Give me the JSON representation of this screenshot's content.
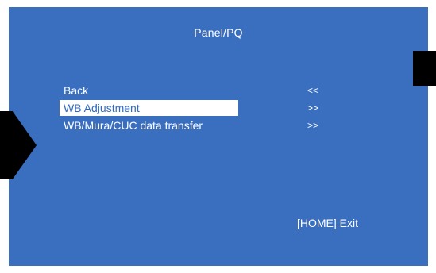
{
  "panel": {
    "title": "Panel/PQ"
  },
  "menu": {
    "items": [
      {
        "label": "Back",
        "arrow": "<<",
        "selected": false
      },
      {
        "label": "WB Adjustment",
        "arrow": ">>",
        "selected": true
      },
      {
        "label": "WB/Mura/CUC data transfer",
        "arrow": ">>",
        "selected": false
      }
    ]
  },
  "footer": {
    "exit_label": "[HOME] Exit"
  },
  "colors": {
    "osd_background": "#3a6fc0",
    "highlight": "#ffffff",
    "highlight_text": "#2f6bc4",
    "text": "#ffffff",
    "marker": "#000000"
  }
}
